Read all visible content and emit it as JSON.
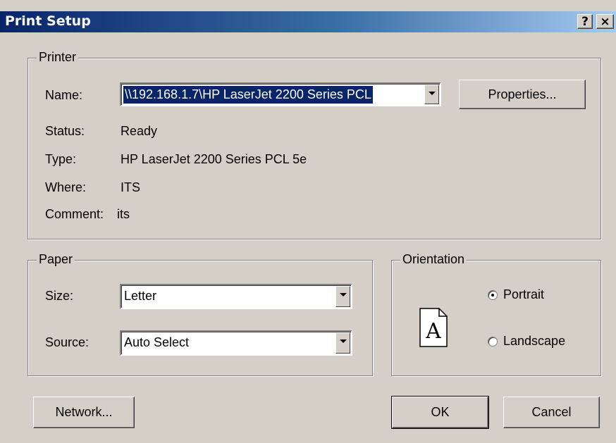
{
  "window": {
    "title": "Print Setup",
    "help_label": "?",
    "close_label": "×"
  },
  "printer": {
    "group_label": "Printer",
    "name_label": "Name:",
    "name_value": "\\\\192.168.1.7\\HP LaserJet 2200 Series PCL",
    "properties_label": "Properties...",
    "status_label": "Status:",
    "status_value": "Ready",
    "type_label": "Type:",
    "type_value": "HP LaserJet 2200 Series PCL 5e",
    "where_label": "Where:",
    "where_value": "ITS",
    "comment_label": "Comment:",
    "comment_value": "its"
  },
  "paper": {
    "group_label": "Paper",
    "size_label": "Size:",
    "size_value": "Letter",
    "source_label": "Source:",
    "source_value": "Auto Select"
  },
  "orientation": {
    "group_label": "Orientation",
    "icon_letter": "A",
    "portrait_label": "Portrait",
    "landscape_label": "Landscape",
    "selected": "Portrait"
  },
  "buttons": {
    "network_label": "Network...",
    "ok_label": "OK",
    "cancel_label": "Cancel"
  },
  "colors": {
    "titlebar_start": "#0a246a",
    "titlebar_end": "#a6caf0",
    "dialog_bg": "#d4d0c8",
    "selection": "#0a246a"
  },
  "icons": [
    "help-icon",
    "close-icon",
    "dropdown-arrow-icon",
    "portrait-page-icon"
  ]
}
